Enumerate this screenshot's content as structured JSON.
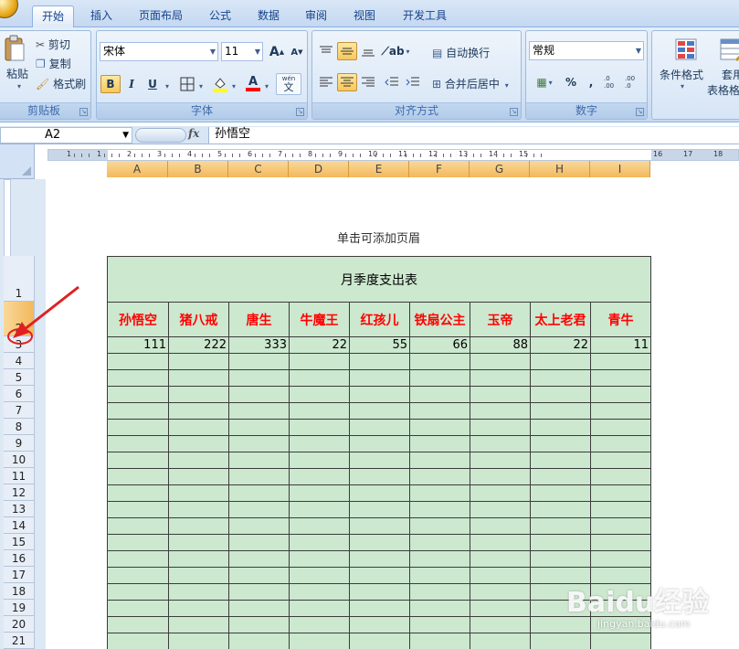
{
  "tabs": [
    "开始",
    "插入",
    "页面布局",
    "公式",
    "数据",
    "审阅",
    "视图",
    "开发工具"
  ],
  "active_tab": "开始",
  "clipboard": {
    "paste_label": "粘贴",
    "cut_label": "剪切",
    "copy_label": "复制",
    "format_painter_label": "格式刷",
    "group_label": "剪贴板"
  },
  "font": {
    "family": "宋体",
    "size": "11",
    "grow_label": "A",
    "shrink_label": "A",
    "bold_label": "B",
    "italic_label": "I",
    "underline_label": "U",
    "fill_color": "#ffff00",
    "font_color_label": "A",
    "font_color": "#ff0000",
    "phonetic_label": "wén",
    "phonetic_char": "文",
    "group_label": "字体"
  },
  "alignment": {
    "wrap_label": "自动换行",
    "merge_label": "合并后居中",
    "group_label": "对齐方式"
  },
  "number": {
    "format": "常规",
    "percent_label": "%",
    "comma_label": ",",
    "inc_decimal_label": ".0 .00",
    "dec_decimal_label": ".00 .0",
    "group_label": "数字"
  },
  "styles": {
    "cond_format_label": "条件格式",
    "table_format_label_1": "套用",
    "table_format_label_2": "表格格"
  },
  "formula_bar": {
    "name_box": "A2",
    "fx": "fx",
    "content": "孙悟空"
  },
  "ruler": {
    "left_numbers": [
      "1",
      "1",
      "2",
      "3",
      "4",
      "5",
      "6",
      "7",
      "8",
      "9",
      "10",
      "11",
      "12",
      "13",
      "14",
      "15"
    ],
    "right_numbers": [
      "16",
      "17",
      "18"
    ]
  },
  "columns": [
    "A",
    "B",
    "C",
    "D",
    "E",
    "F",
    "G",
    "H",
    "I"
  ],
  "rows": [
    "1",
    "2",
    "3",
    "4",
    "5",
    "6",
    "7",
    "8",
    "9",
    "10",
    "11",
    "12",
    "13",
    "14",
    "15",
    "16",
    "17",
    "18",
    "19",
    "20",
    "21"
  ],
  "page": {
    "header_hint": "单击可添加页眉"
  },
  "sheet": {
    "title": "月季度支出表",
    "headers": [
      "孙悟空",
      "猪八戒",
      "唐生",
      "牛魔王",
      "红孩儿",
      "铁扇公主",
      "玉帝",
      "太上老君",
      "青牛"
    ],
    "values": [
      "111",
      "222",
      "333",
      "22",
      "55",
      "66",
      "88",
      "22",
      "11"
    ]
  },
  "watermark": {
    "logo": "Baidu经验",
    "url": "jingyan.baidu.com"
  },
  "colors": {
    "cell_fill": "#cce8cf",
    "header_text": "#ff0000",
    "selected_header": "#f3b85c",
    "annotation": "#e02020"
  }
}
